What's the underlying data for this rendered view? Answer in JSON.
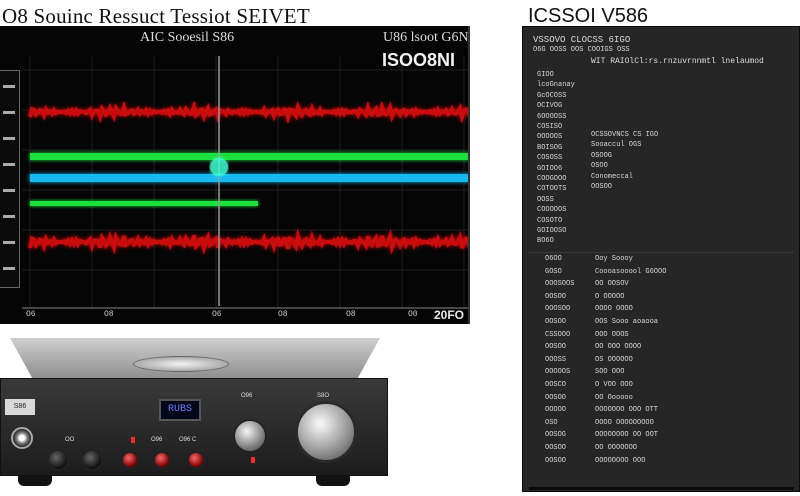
{
  "titles": {
    "left": "O8 Souinc Ressuct Tessiot SEIVET",
    "right": "ICSSOI V586"
  },
  "scope": {
    "header_left": "AIC Sooesil S86",
    "header_right": "U86 lsoot G6N",
    "subheader": "ISOO8NI",
    "zoom_label": "20FO",
    "x_ticks": [
      "O6",
      "O8",
      "O6",
      "O8",
      "O8",
      "O0"
    ],
    "colors": {
      "red": "#e01010",
      "green": "#1ee03a",
      "cyan": "#19b8f0",
      "cursor_glow": "#3dffd0"
    }
  },
  "amplifier": {
    "badge": "S86",
    "display": "RUBS",
    "labels": [
      "OO",
      "O96",
      "O96 C",
      "O96",
      "S8O"
    ]
  },
  "spec": {
    "header": "VSSOVO   CLOCSS 6IGO",
    "header_line2": "O6G  OOSS OOS  COOIGS OSS",
    "subheader": "WIT RAIOlCl:rs.rnzuvrnnmtl lnelaumod",
    "top_left": [
      "GIOO",
      "lcoGnanay",
      "GcOCOSS",
      "OCIVOG",
      "6OOOOSS",
      "COSISO",
      "OOOOOS",
      "BOISOG",
      "COSOSS",
      "GOIOO6",
      "COOGOOO",
      "COTOOTS",
      "OOSS",
      "COOOOOS",
      "COSOTO",
      "GOIOOSO",
      "BO6O"
    ],
    "top_right": [
      "OCSSOVNCS CS IGO",
      "Sooaccul OGS",
      "OSOOG",
      "OSOO",
      "Conomeccal",
      "OOSOO"
    ],
    "bottom_left": [
      "O6OO",
      "GOSO",
      "OOOSOOS",
      "OOSOO",
      "OOOSOO",
      "OOSOO",
      "CSSOOO",
      "OOSOO",
      "OOOSS",
      "OOOOOS",
      "OOSCO",
      "OOSOO",
      "OOOOO",
      "OSO",
      "OOSOG",
      "OOSOO",
      "OOSOO"
    ],
    "bottom_right": [
      "Ooy Soooy",
      "Coooasooool G6OOO",
      "OO OOSOV",
      "O OOOOO",
      "OOOO OOOO",
      "OOS Sooo aoaooa",
      "OOO OOOS",
      "OO OOO OOOO",
      "OS OOOOOO",
      "SOO OOO",
      "O VOO OOO",
      "OO Oooooo",
      "OOOOOOO OOO OTT",
      "OOOO OOOOOOOOO",
      "OOOOOOOO OO OOT",
      "OO OOOOOOO",
      "OOOOOOOO OOO"
    ]
  }
}
